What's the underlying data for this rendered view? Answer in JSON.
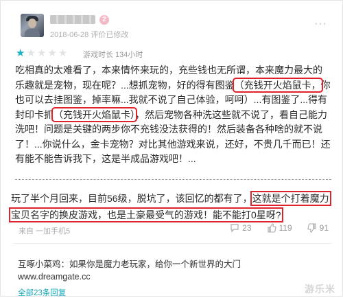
{
  "review": {
    "username": "████████",
    "level_badge": "2",
    "date_line": "2018-06-28 评价已修改",
    "rating_stars": 1,
    "rating_max": 5,
    "playtime": "游戏时长 134小时",
    "paragraph1": [
      {
        "text": "吃相真的太难看了，本来情怀来玩的，充些钱也无所谓，本来魔力最大的乐趣就是宠物，现在呢？...想抓宠物，好的得有图鉴",
        "hl": false
      },
      {
        "text": "（充钱开火焰鼠卡，",
        "hl": true
      },
      {
        "text": "你也可以去挂图鉴，掉率嘛...我就不说了自己体验，呵呵）...有图鉴了...得有封印卡抓",
        "hl": false
      },
      {
        "text": "（充钱开火焰鼠卡）",
        "hl": true
      },
      {
        "text": "，然后宠物各种洗这些就不说了，看自己能力洗吧！问题是关键的两步你不充钱没法获得的！然后装备各种啥的就不说了！...你说什么，金卡宠物？对比其他游戏来说，还好，不贵几千而已！还有能不能告诉我下，这是半成品游戏吧！...",
        "hl": false
      }
    ],
    "paragraph2": [
      {
        "text": "玩了半个月回来，目前56级，脱坑了，该回忆的都有了，",
        "hl": false
      },
      {
        "text": "这就是个打着魔力宝贝名字的换皮游戏，也是土豪最受气的游戏！能不能打0星呀?",
        "hl": true
      }
    ],
    "device": "来自 一加手机5",
    "actions": {
      "comments": "23",
      "likes": "119",
      "dislikes": "91"
    }
  },
  "reply": {
    "text": "互啄小菜鸡：如果你是魔力老玩家，给你一个新世界的大门",
    "link": "www.dreamgate.cc",
    "all_replies": "全部23条回复"
  },
  "watermark": "游乐米",
  "colors": {
    "accent": "#19b3c3",
    "highlight_border": "#e0232b"
  }
}
